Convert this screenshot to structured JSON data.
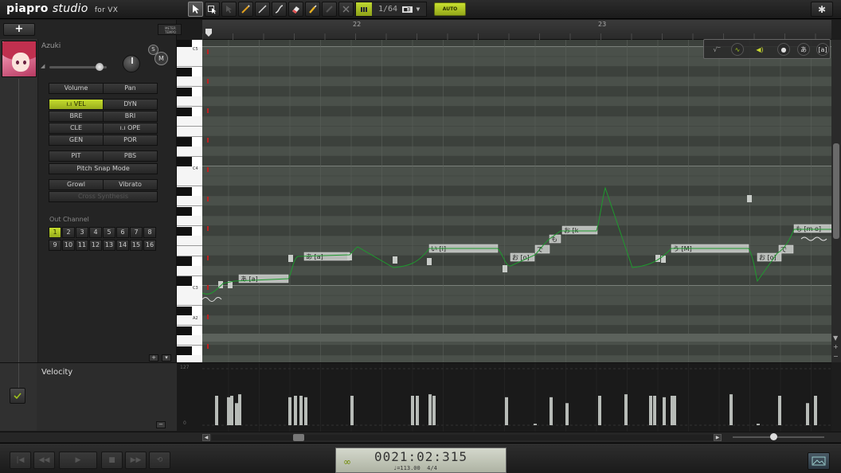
{
  "app": {
    "logo_main": "piapro",
    "logo_bold": "studio",
    "logo_suffix": "for VX"
  },
  "toolbar": {
    "tools": [
      {
        "name": "pointer-tool-button",
        "icon": "pointer-icon",
        "active": true
      },
      {
        "name": "select-tool-button",
        "icon": "multi-select-icon",
        "active": false
      },
      {
        "name": "grab-tool-button",
        "icon": "grab-icon",
        "active": false
      },
      {
        "name": "pencil-tool-button",
        "icon": "pencil-icon",
        "active": false
      },
      {
        "name": "line-tool-button",
        "icon": "line-icon",
        "active": false
      },
      {
        "name": "curve-tool-button",
        "icon": "curve-icon",
        "active": false
      },
      {
        "name": "eraser-tool-button",
        "icon": "eraser-icon",
        "active": false
      },
      {
        "name": "paint-tool-button",
        "icon": "brush-icon",
        "active": false
      },
      {
        "name": "dimmed-tool-button",
        "icon": "pen-icon",
        "active": false
      },
      {
        "name": "cross-tool-button",
        "icon": "cross-icon",
        "active": false
      }
    ],
    "quantize_value": "1/64",
    "quantize_tag": "■3",
    "auto_label": "AUTO",
    "accent_color": "#b4cc26"
  },
  "left_panel": {
    "singer_name": "Azuki",
    "meter_label": "METER",
    "tempo_label": "TEMPO",
    "solo_label": "S",
    "mute_label": "M",
    "buttons": {
      "volume": "Volume",
      "pan": "Pan",
      "vel": "VEL",
      "dyn": "DYN",
      "bre": "BRE",
      "bri": "BRI",
      "cle": "CLE",
      "ope": "OPE",
      "gen": "GEN",
      "por": "POR",
      "pit": "PIT",
      "pbs": "PBS",
      "pitch_snap": "Pitch Snap Mode",
      "growl": "Growl",
      "vibrato": "Vibrato",
      "cross_synthesis": "Cross Synthesis"
    },
    "out_channel_label": "Out Channel",
    "channels": [
      "1",
      "2",
      "3",
      "4",
      "5",
      "6",
      "7",
      "8",
      "9",
      "10",
      "11",
      "12",
      "13",
      "14",
      "15",
      "16"
    ],
    "active_channel": "1",
    "add_label": "+",
    "remove_label": "−"
  },
  "roll": {
    "bar_numbers": [
      {
        "label": "22"
      },
      {
        "label": "23"
      }
    ],
    "key_labels": {
      "c5": "C5",
      "c4": "C4",
      "c3": "C3",
      "a2": "A2"
    },
    "notes": [
      {
        "lyric": "あ",
        "phoneme": "[a]"
      },
      {
        "lyric": "あ",
        "phoneme": "[a]"
      },
      {
        "lyric": "い",
        "phoneme": "[i]"
      },
      {
        "lyric": "お",
        "phoneme": "[o]"
      },
      {
        "lyric": "う",
        "phoneme": "[M]"
      },
      {
        "lyric": "む",
        "phoneme": "[m]"
      },
      {
        "lyric": "お",
        "phoneme": "[k"
      },
      {
        "lyric": "で",
        "phoneme": ""
      },
      {
        "lyric": "も",
        "phoneme": ""
      },
      {
        "lyric": "も",
        "phoneme": "[m o]"
      }
    ]
  },
  "velocity": {
    "label": "Velocity",
    "scale_top": "127",
    "scale_bottom": "0",
    "bar_values": [
      40,
      38,
      40,
      30,
      42,
      38,
      40,
      40,
      38,
      40,
      40,
      40,
      42,
      40,
      38,
      2,
      38,
      30,
      40,
      42,
      40,
      40,
      38,
      40,
      40,
      42,
      2,
      40,
      30,
      40
    ]
  },
  "transport": {
    "time": "0021:02:315",
    "tempo": "♩=113.00",
    "signature": "4/4"
  }
}
